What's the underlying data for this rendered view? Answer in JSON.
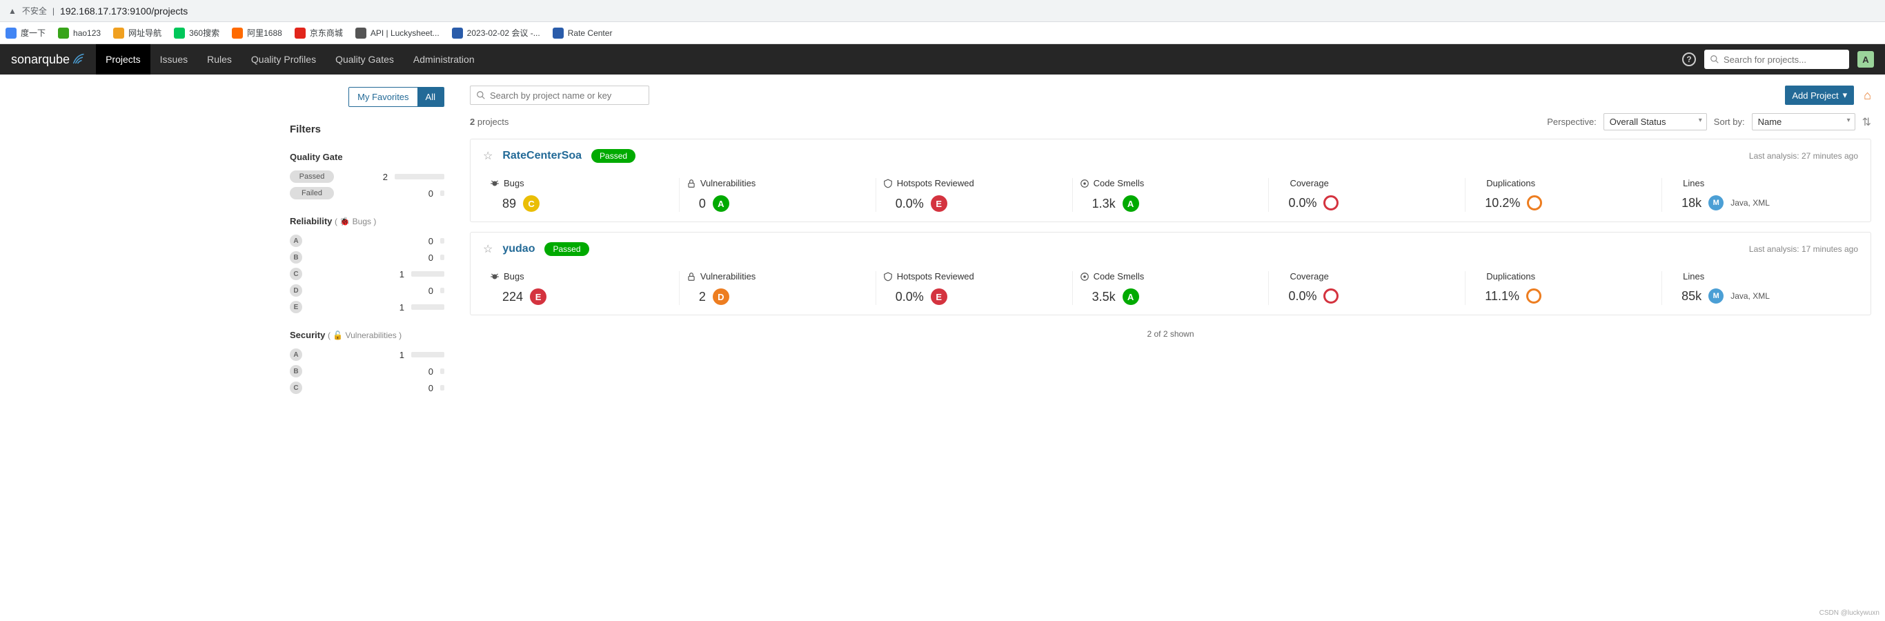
{
  "browser": {
    "insecure_label": "不安全",
    "url_display": "192.168.17.173:9100/projects"
  },
  "bookmarks": [
    {
      "label": "度一下",
      "color": "#4285f4"
    },
    {
      "label": "hao123",
      "color": "#38a41a"
    },
    {
      "label": "网址导航",
      "color": "#f0a020"
    },
    {
      "label": "360搜索",
      "color": "#00c75a"
    },
    {
      "label": "阿里1688",
      "color": "#ff6a00"
    },
    {
      "label": "京东商城",
      "color": "#e1251b"
    },
    {
      "label": "API | Luckysheet...",
      "color": "#555"
    },
    {
      "label": "2023-02-02 会议 -...",
      "color": "#2a5caa"
    },
    {
      "label": "Rate Center",
      "color": "#2a5caa"
    }
  ],
  "nav": {
    "brand": "sonarqube",
    "items": [
      "Projects",
      "Issues",
      "Rules",
      "Quality Profiles",
      "Quality Gates",
      "Administration"
    ],
    "active_index": 0,
    "search_placeholder": "Search for projects...",
    "avatar_initial": "A"
  },
  "sidebar": {
    "seg_my_favorites": "My Favorites",
    "seg_all": "All",
    "filters_title": "Filters",
    "quality_gate": {
      "title": "Quality Gate",
      "rows": [
        {
          "label": "Passed",
          "count": "2",
          "bar": "wfull"
        },
        {
          "label": "Failed",
          "count": "0",
          "bar": "w0"
        }
      ]
    },
    "reliability": {
      "title": "Reliability",
      "sub": "( 🐞 Bugs )",
      "rows": [
        {
          "grade": "A",
          "count": "0",
          "bar": "w0"
        },
        {
          "grade": "B",
          "count": "0",
          "bar": "w0"
        },
        {
          "grade": "C",
          "count": "1",
          "bar": "w1"
        },
        {
          "grade": "D",
          "count": "0",
          "bar": "w0"
        },
        {
          "grade": "E",
          "count": "1",
          "bar": "w1"
        }
      ]
    },
    "security": {
      "title": "Security",
      "sub": "( 🔓 Vulnerabilities )",
      "rows": [
        {
          "grade": "A",
          "count": "1",
          "bar": "w1"
        },
        {
          "grade": "B",
          "count": "0",
          "bar": "w0"
        },
        {
          "grade": "C",
          "count": "0",
          "bar": "w0"
        }
      ]
    }
  },
  "main": {
    "search_placeholder": "Search by project name or key",
    "add_project": "Add Project",
    "count_prefix": "2",
    "count_suffix": " projects",
    "perspective_label": "Perspective:",
    "perspective_value": "Overall Status",
    "sort_label": "Sort by:",
    "sort_value": "Name",
    "footer": "2 of 2 shown",
    "metric_labels": {
      "bugs": "Bugs",
      "vuln": "Vulnerabilities",
      "hotspots": "Hotspots Reviewed",
      "smells": "Code Smells",
      "coverage": "Coverage",
      "dup": "Duplications",
      "lines": "Lines"
    },
    "projects": [
      {
        "name": "RateCenterSoa",
        "status": "Passed",
        "analysis": "Last analysis: 27 minutes ago",
        "bugs": {
          "val": "89",
          "rating": "C"
        },
        "vuln": {
          "val": "0",
          "rating": "A"
        },
        "hotspots": {
          "val": "0.0%",
          "rating": "E"
        },
        "smells": {
          "val": "1.3k",
          "rating": "A"
        },
        "coverage": {
          "val": "0.0%"
        },
        "dup": {
          "val": "10.2%"
        },
        "lines": {
          "val": "18k",
          "chip": "M",
          "langs": "Java, XML"
        }
      },
      {
        "name": "yudao",
        "status": "Passed",
        "analysis": "Last analysis: 17 minutes ago",
        "bugs": {
          "val": "224",
          "rating": "E"
        },
        "vuln": {
          "val": "2",
          "rating": "D"
        },
        "hotspots": {
          "val": "0.0%",
          "rating": "E"
        },
        "smells": {
          "val": "3.5k",
          "rating": "A"
        },
        "coverage": {
          "val": "0.0%"
        },
        "dup": {
          "val": "11.1%"
        },
        "lines": {
          "val": "85k",
          "chip": "M",
          "langs": "Java, XML"
        }
      }
    ]
  },
  "watermark": "CSDN @luckywuxn"
}
